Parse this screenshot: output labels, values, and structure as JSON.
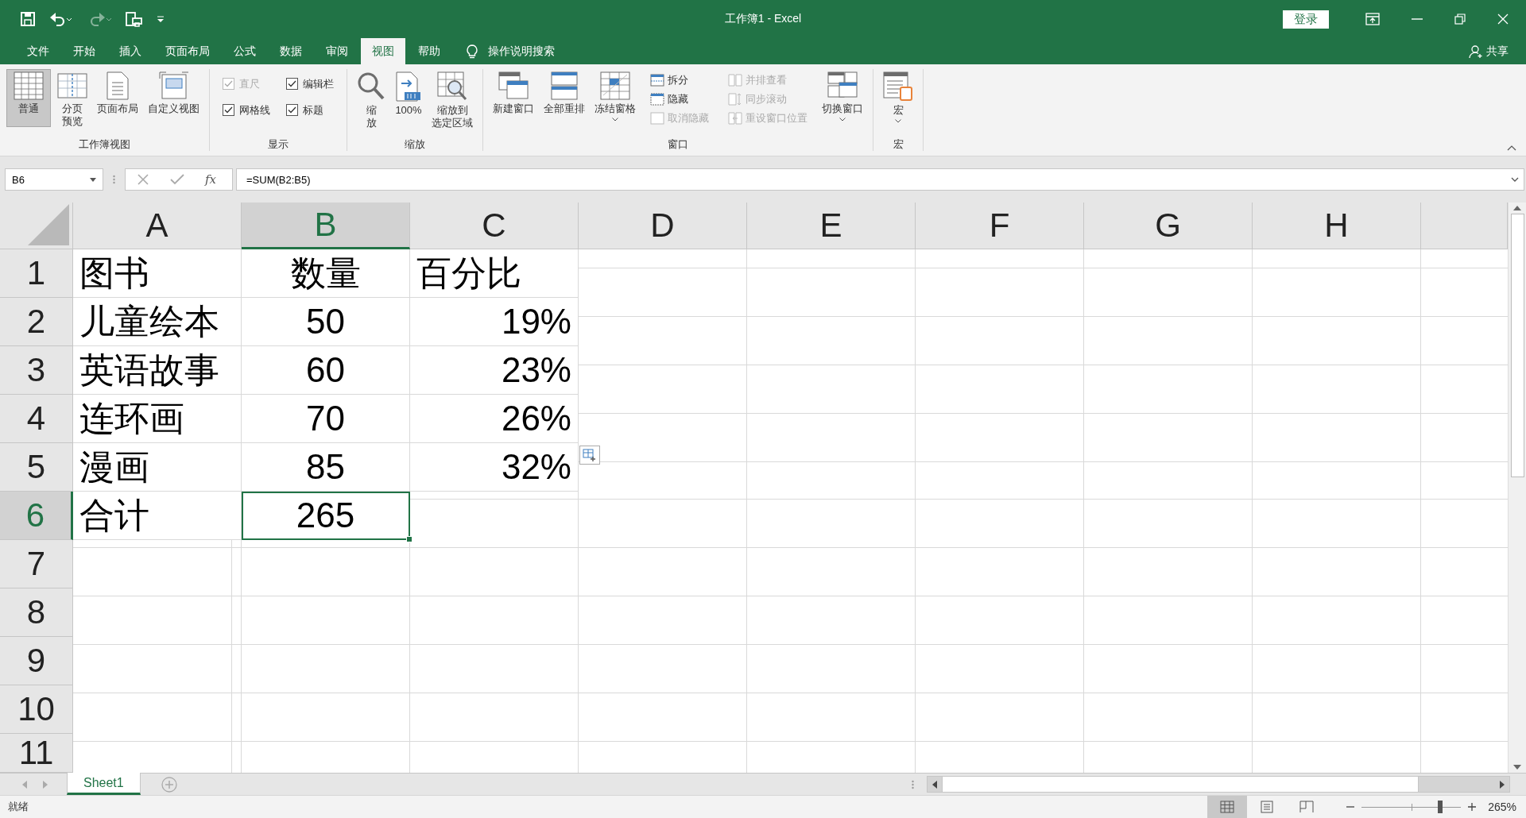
{
  "window": {
    "title": "工作簿1  -  Excel",
    "sign_in": "登录"
  },
  "quick_access": [
    {
      "kind": "save",
      "disabled": false
    },
    {
      "kind": "undo",
      "disabled": false
    },
    {
      "kind": "redo",
      "disabled": true
    },
    {
      "kind": "print-preview",
      "disabled": false
    },
    {
      "kind": "customize",
      "disabled": false
    }
  ],
  "tabs": [
    {
      "label": "文件",
      "selected": false
    },
    {
      "label": "开始",
      "selected": false
    },
    {
      "label": "插入",
      "selected": false
    },
    {
      "label": "页面布局",
      "selected": false
    },
    {
      "label": "公式",
      "selected": false
    },
    {
      "label": "数据",
      "selected": false
    },
    {
      "label": "审阅",
      "selected": false
    },
    {
      "label": "视图",
      "selected": true
    },
    {
      "label": "帮助",
      "selected": false
    }
  ],
  "tell_me": "操作说明搜索",
  "share": "共享",
  "ribbon": {
    "groups": [
      {
        "label": "工作簿视图",
        "items": [
          {
            "kind": "large",
            "lines": [
              "普通"
            ],
            "selected": true,
            "disabled": false,
            "dropdown": false
          },
          {
            "kind": "large",
            "lines": [
              "分页",
              "预览"
            ],
            "selected": false,
            "disabled": false,
            "dropdown": false
          },
          {
            "kind": "large",
            "lines": [
              "页面布局"
            ],
            "selected": false,
            "disabled": false,
            "dropdown": false
          },
          {
            "kind": "large",
            "lines": [
              "自定义视图"
            ],
            "selected": false,
            "disabled": false,
            "dropdown": false
          }
        ]
      },
      {
        "label": "显示",
        "items": [
          {
            "kind": "check",
            "label": "直尺",
            "checked": true,
            "disabled": true
          },
          {
            "kind": "check",
            "label": "网格线",
            "checked": true,
            "disabled": false
          },
          {
            "kind": "check",
            "label": "编辑栏",
            "checked": true,
            "disabled": false
          },
          {
            "kind": "check",
            "label": "标题",
            "checked": true,
            "disabled": false
          }
        ]
      },
      {
        "label": "缩放",
        "items": [
          {
            "kind": "large",
            "lines": [
              "缩",
              "放"
            ],
            "selected": false,
            "disabled": false,
            "dropdown": false
          },
          {
            "kind": "large",
            "lines": [
              "100%"
            ],
            "selected": false,
            "disabled": false,
            "dropdown": false
          },
          {
            "kind": "large",
            "lines": [
              "缩放到",
              "选定区域"
            ],
            "selected": false,
            "disabled": false,
            "dropdown": false
          }
        ]
      },
      {
        "label": "窗口",
        "items": [
          {
            "kind": "large",
            "lines": [
              "新建窗口"
            ],
            "selected": false,
            "disabled": false,
            "dropdown": false
          },
          {
            "kind": "large",
            "lines": [
              "全部重排"
            ],
            "selected": false,
            "disabled": false,
            "dropdown": false
          },
          {
            "kind": "large",
            "lines": [
              "冻结窗格"
            ],
            "selected": false,
            "disabled": false,
            "dropdown": true
          },
          {
            "kind": "small",
            "label": "拆分",
            "disabled": false
          },
          {
            "kind": "small",
            "label": "隐藏",
            "disabled": false
          },
          {
            "kind": "small",
            "label": "取消隐藏",
            "disabled": true
          },
          {
            "kind": "small",
            "label": "并排查看",
            "disabled": true
          },
          {
            "kind": "small",
            "label": "同步滚动",
            "disabled": true
          },
          {
            "kind": "small",
            "label": "重设窗口位置",
            "disabled": true
          },
          {
            "kind": "large",
            "lines": [
              "切换窗口"
            ],
            "selected": false,
            "disabled": false,
            "dropdown": true
          }
        ]
      },
      {
        "label": "宏",
        "items": [
          {
            "kind": "large",
            "lines": [
              "宏"
            ],
            "selected": false,
            "disabled": false,
            "dropdown": true
          }
        ]
      }
    ]
  },
  "formula_bar": {
    "name_box": "B6",
    "insert_function": "fx",
    "formula": "=SUM(B2:B5)"
  },
  "sheet": {
    "columns": [
      {
        "label": "A",
        "selected": false
      },
      {
        "label": "B",
        "selected": true
      },
      {
        "label": "C",
        "selected": false
      },
      {
        "label": "D",
        "selected": false
      },
      {
        "label": "E",
        "selected": false
      },
      {
        "label": "F",
        "selected": false
      },
      {
        "label": "G",
        "selected": false
      },
      {
        "label": "H",
        "selected": false
      }
    ],
    "rows": [
      {
        "label": "1",
        "selected": false,
        "cells": [
          {
            "text": "图书",
            "kind": "text",
            "active": false
          },
          {
            "text": "数量",
            "kind": "centered",
            "active": false
          },
          {
            "text": "百分比",
            "kind": "text",
            "active": false
          }
        ]
      },
      {
        "label": "2",
        "selected": false,
        "cells": [
          {
            "text": "儿童绘本",
            "kind": "text",
            "active": false
          },
          {
            "text": "50",
            "kind": "centered",
            "active": false
          },
          {
            "text": "19%",
            "kind": "number",
            "active": false
          }
        ]
      },
      {
        "label": "3",
        "selected": false,
        "cells": [
          {
            "text": "英语故事",
            "kind": "text",
            "active": false
          },
          {
            "text": "60",
            "kind": "centered",
            "active": false
          },
          {
            "text": "23%",
            "kind": "number",
            "active": false
          }
        ]
      },
      {
        "label": "4",
        "selected": false,
        "cells": [
          {
            "text": "连环画",
            "kind": "text",
            "active": false
          },
          {
            "text": "70",
            "kind": "centered",
            "active": false
          },
          {
            "text": "26%",
            "kind": "number",
            "active": false
          }
        ]
      },
      {
        "label": "5",
        "selected": false,
        "cells": [
          {
            "text": "漫画",
            "kind": "text",
            "active": false
          },
          {
            "text": "85",
            "kind": "centered",
            "active": false
          },
          {
            "text": "32%",
            "kind": "number",
            "active": false
          }
        ]
      },
      {
        "label": "6",
        "selected": true,
        "cells": [
          {
            "text": "合计",
            "kind": "text",
            "active": false
          },
          {
            "text": "265",
            "kind": "centered",
            "active": true
          }
        ]
      },
      {
        "label": "7",
        "selected": false
      },
      {
        "label": "8",
        "selected": false
      },
      {
        "label": "9",
        "selected": false
      },
      {
        "label": "10",
        "selected": false
      },
      {
        "label": "11",
        "selected": false
      }
    ]
  },
  "sheet_tabs": [
    {
      "label": "Sheet1",
      "selected": true
    }
  ],
  "status_bar": {
    "text": "就绪",
    "views": [
      {
        "kind": "normal",
        "selected": true
      },
      {
        "kind": "page-layout",
        "selected": false
      },
      {
        "kind": "page-break",
        "selected": false
      }
    ],
    "zoom": {
      "level": 0.79,
      "reading": "265%"
    }
  }
}
